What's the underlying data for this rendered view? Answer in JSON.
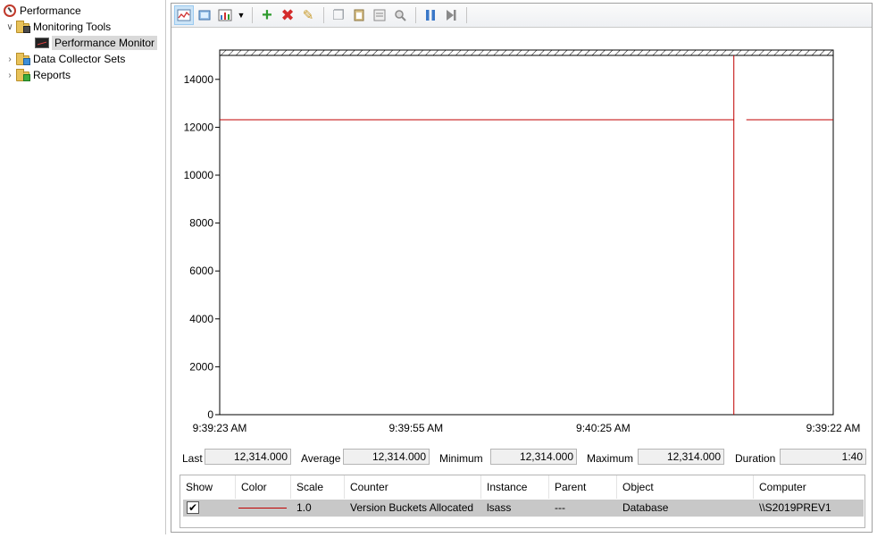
{
  "tree": {
    "root": "Performance",
    "monitoring_tools": "Monitoring Tools",
    "performance_monitor": "Performance Monitor",
    "data_collector_sets": "Data Collector Sets",
    "reports": "Reports"
  },
  "toolbar": {
    "icons": [
      "view-graph-icon",
      "freeze-display-icon",
      "change-graph-type-icon",
      "add-counter-icon",
      "delete-counter-icon",
      "highlight-icon",
      "copy-properties-icon",
      "paste-counter-list-icon",
      "properties-icon",
      "zoom-icon",
      "freeze-icon",
      "update-data-icon"
    ]
  },
  "chart_data": {
    "type": "line",
    "ylim": [
      0,
      15000
    ],
    "yticks": [
      "14000",
      "12000",
      "10000",
      "8000",
      "6000",
      "4000",
      "2000",
      "0"
    ],
    "yticks_values": [
      14000,
      12000,
      10000,
      8000,
      6000,
      4000,
      2000,
      0
    ],
    "xtick_labels": [
      "9:39:23 AM",
      "9:39:55 AM",
      "9:40:25 AM",
      "9:39:22 AM"
    ],
    "time_cursor_fraction": 0.838,
    "series": [
      {
        "color": "#c00000",
        "value": 12314
      }
    ]
  },
  "stats": {
    "last_label": "Last",
    "last_value": "12,314.000",
    "average_label": "Average",
    "average_value": "12,314.000",
    "minimum_label": "Minimum",
    "minimum_value": "12,314.000",
    "maximum_label": "Maximum",
    "maximum_value": "12,314.000",
    "duration_label": "Duration",
    "duration_value": "1:40"
  },
  "counter_table": {
    "headers": [
      "Show",
      "Color",
      "Scale",
      "Counter",
      "Instance",
      "Parent",
      "Object",
      "Computer"
    ],
    "rows": [
      {
        "show": "✔",
        "scale": "1.0",
        "counter": "Version Buckets Allocated",
        "instance": "lsass",
        "parent": "---",
        "object": "Database",
        "computer": "\\\\S2019PREV1"
      }
    ]
  },
  "colors": {
    "series_line": "#c00000",
    "selected_row": "#c8c8c8"
  }
}
